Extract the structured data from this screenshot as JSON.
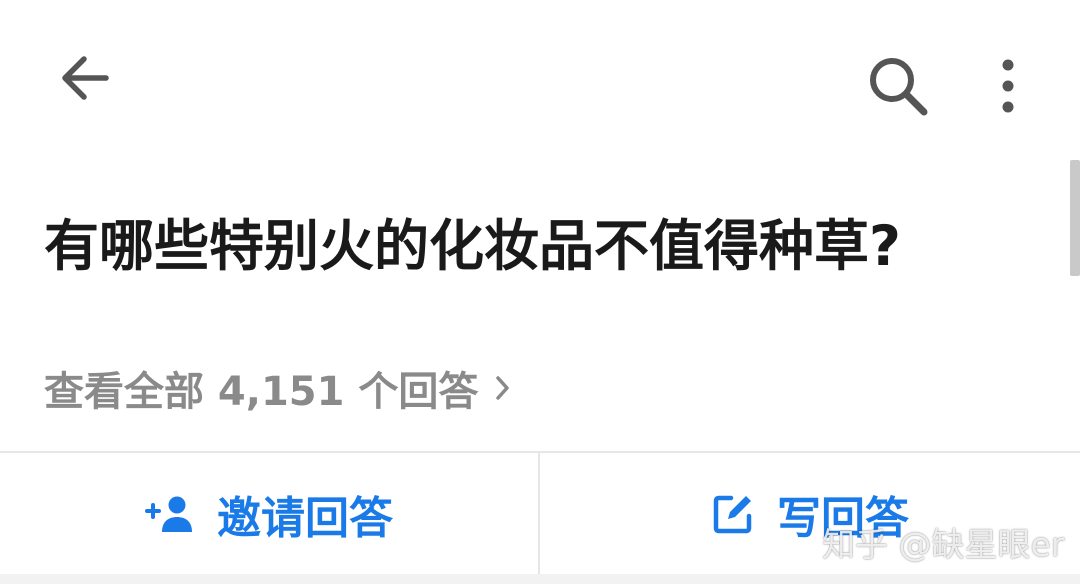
{
  "toolbar": {
    "back_icon": "arrow-left-icon",
    "search_icon": "search-icon",
    "more_icon": "more-vertical-icon"
  },
  "question": {
    "title": "有哪些特别火的化妆品不值得种草?"
  },
  "answers_link": {
    "label": "查看全部 4,151 个回答",
    "icon": "chevron-right-icon"
  },
  "actions": {
    "invite": {
      "label": "邀请回答",
      "icon": "add-user-icon"
    },
    "write": {
      "label": "写回答",
      "icon": "edit-icon"
    }
  },
  "watermark": {
    "text": "知乎 @缺星眼er"
  },
  "colors": {
    "accent": "#1a7ae8",
    "title": "#1a1a1a",
    "muted": "#8a8a8a",
    "icon": "#555555"
  }
}
